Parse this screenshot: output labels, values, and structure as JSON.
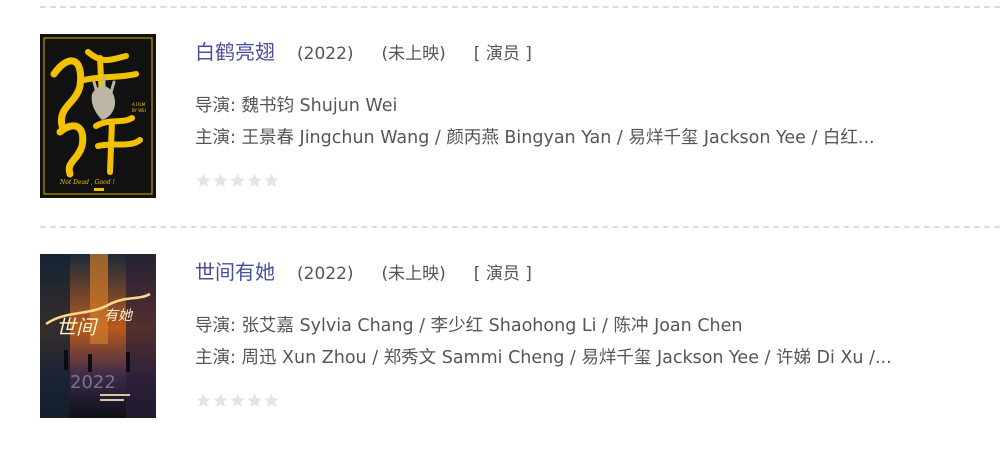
{
  "movies": [
    {
      "title": "白鹤亮翅",
      "year": "(2022)",
      "status": "(未上映)",
      "role": "[ 演员 ]",
      "director_label": "导演: ",
      "director": "魏书钧 Shujun Wei",
      "cast_label": "主演: ",
      "cast": "王景春 Jingchun Wang / 颜丙燕 Bingyan Yan / 易烊千玺 Jackson Yee / 白红...",
      "rating_stars": 0,
      "poster_icon": "movie-poster-baiheliangchi",
      "poster_logo": "白鹤亮翅",
      "poster_tagline": "Not Dead , Good !"
    },
    {
      "title": "世间有她",
      "year": "(2022)",
      "status": "(未上映)",
      "role": "[ 演员 ]",
      "director_label": "导演: ",
      "director": "张艾嘉 Sylvia Chang / 李少红 Shaohong Li / 陈冲 Joan Chen",
      "cast_label": "主演: ",
      "cast": "周迅 Xun Zhou / 郑秀文 Sammi Cheng / 易烊千玺 Jackson Yee / 许娣 Di Xu /...",
      "rating_stars": 0,
      "poster_icon": "movie-poster-shijianyouta",
      "poster_logo": "世间有她",
      "poster_year": "2022"
    }
  ],
  "colors": {
    "title_link": "#4a4f9c",
    "text": "#555555",
    "star_empty": "#e4e4e4",
    "divider": "#dddddd"
  }
}
